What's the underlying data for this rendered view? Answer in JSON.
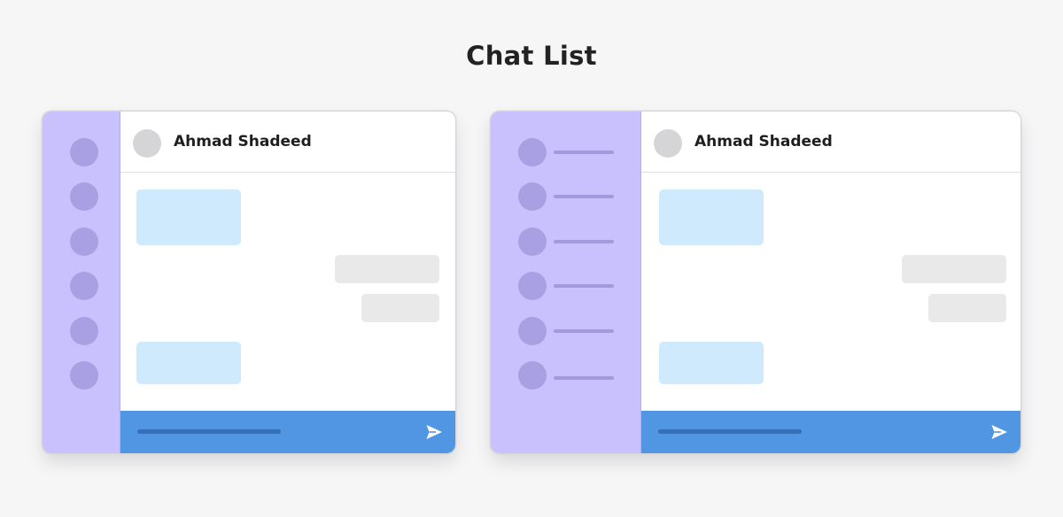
{
  "page": {
    "title": "Chat List"
  },
  "layouts": [
    {
      "sidebar": {
        "style": "avatars-only",
        "items": 6,
        "show_names": false
      },
      "header": {
        "contact_name": "Ahmad Shadeed"
      },
      "messages": [
        "incoming",
        "outgoing",
        "outgoing",
        "incoming"
      ],
      "composer": {
        "send_icon": "send-icon"
      }
    },
    {
      "sidebar": {
        "style": "avatars-with-names",
        "items": 6,
        "show_names": true
      },
      "header": {
        "contact_name": "Ahmad Shadeed"
      },
      "messages": [
        "incoming",
        "outgoing",
        "outgoing",
        "incoming"
      ],
      "composer": {
        "send_icon": "send-icon"
      }
    }
  ],
  "colors": {
    "background": "#f6f6f7",
    "sidebar": "#c8c1fd",
    "sidebar_avatar": "#a99fe3",
    "incoming_bubble": "#cfeafc",
    "outgoing_bubble": "#e9e9ea",
    "composer": "#5096e2",
    "title_text": "#222222"
  }
}
